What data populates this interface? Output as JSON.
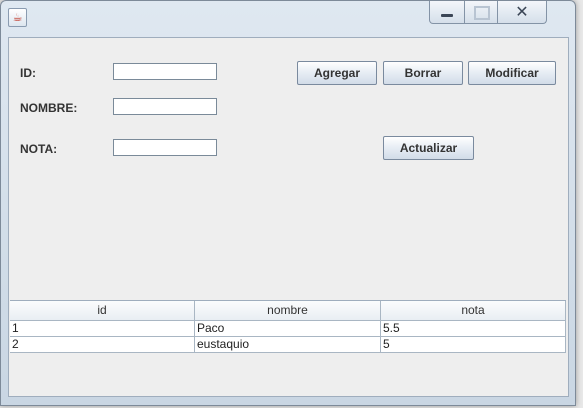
{
  "window": {
    "icon": "java-icon"
  },
  "form": {
    "id_label": "ID:",
    "nombre_label": "NOMBRE:",
    "nota_label": "NOTA:",
    "id_value": "",
    "nombre_value": "",
    "nota_value": ""
  },
  "buttons": {
    "agregar": "Agregar",
    "borrar": "Borrar",
    "modificar": "Modificar",
    "actualizar": "Actualizar"
  },
  "table": {
    "headers": [
      "id",
      "nombre",
      "nota"
    ],
    "rows": [
      [
        "1",
        "Paco",
        "5.5"
      ],
      [
        "2",
        "eustaquio",
        "5"
      ]
    ]
  }
}
